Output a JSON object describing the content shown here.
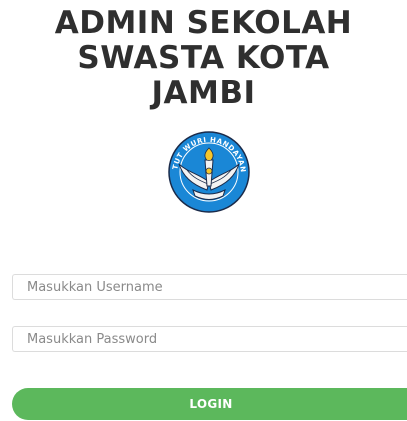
{
  "header": {
    "title_line1": "ADMIN SEKOLAH",
    "title_line2": "SWASTA KOTA",
    "title_line3": "JAMBI"
  },
  "logo": {
    "icon": "tut-wuri-handayani-logo",
    "motto": "TUT WURI HANDAYANI",
    "colors": {
      "ring": "#1a87d6",
      "text": "#ffffff",
      "wings": "#f2f2f2",
      "flame": "#f6c62b",
      "outline": "#1b2b4a"
    }
  },
  "form": {
    "username_placeholder": "Masukkan Username",
    "password_placeholder": "Masukkan Password",
    "login_label": "LOGIN"
  },
  "colors": {
    "title": "#2f2f2f",
    "button": "#5cb85c",
    "border": "#dcdcdc"
  }
}
